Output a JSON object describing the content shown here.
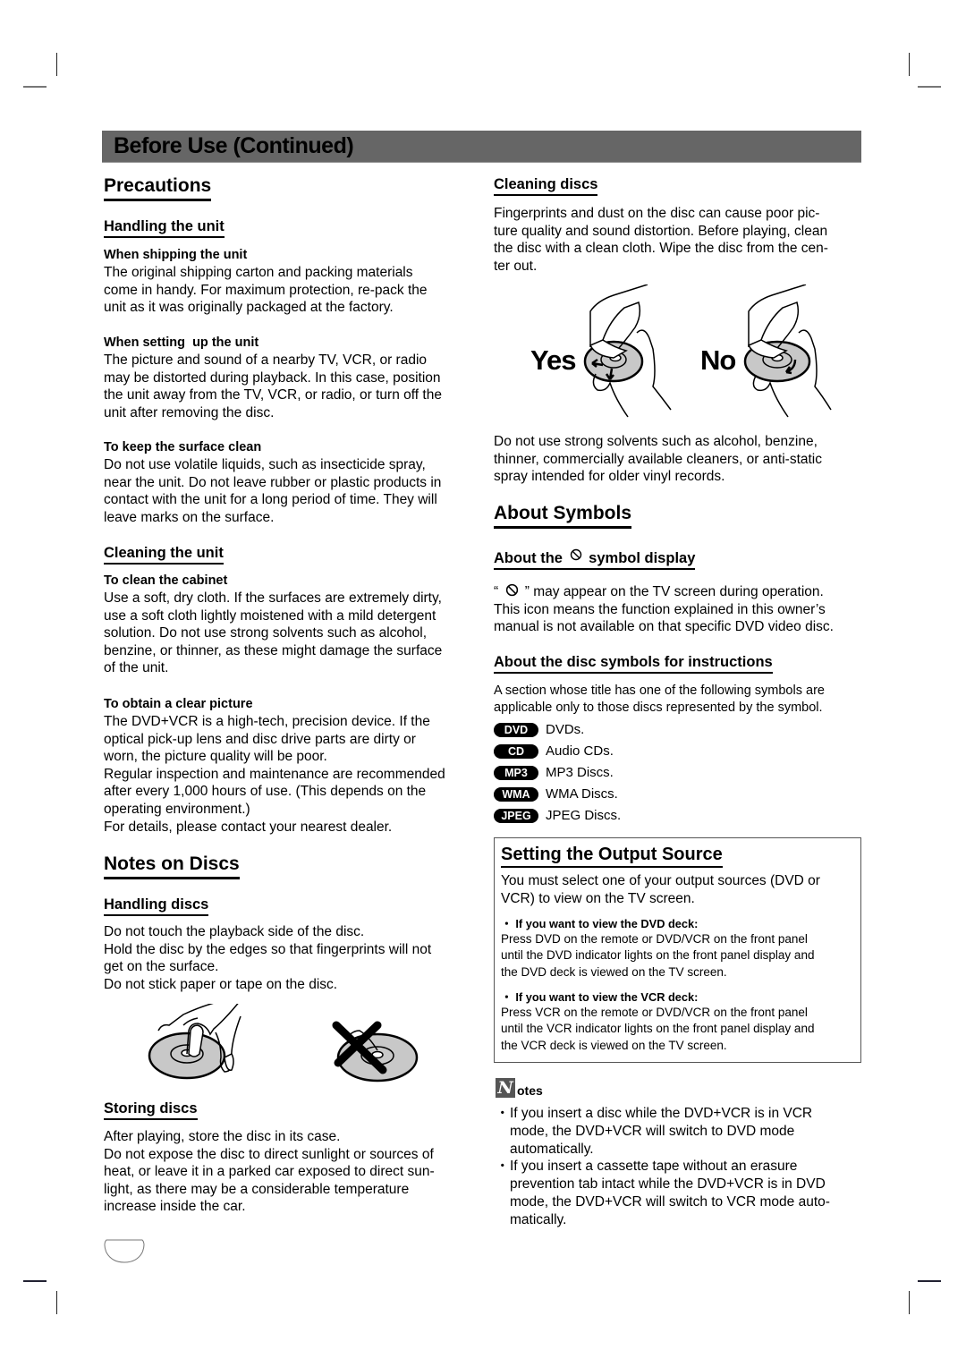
{
  "header": {
    "title": "Before Use (Continued)"
  },
  "left_column": {
    "precautions": {
      "title": "Precautions",
      "handling_unit": {
        "title": "Handling the unit",
        "shipping": {
          "title": "When shipping the unit",
          "lines": [
            "The original shipping carton and packing materials",
            "come in handy. For maximum protection, re-pack the",
            "unit as it was originally packaged at the factory."
          ]
        },
        "setting_up": {
          "title": "When setting  up the unit",
          "lines": [
            "The picture and sound of a nearby TV, VCR, or radio",
            "may be distorted during playback. In this case, position",
            "the unit away from the TV, VCR, or radio, or turn off the",
            "unit after removing the disc."
          ]
        },
        "surface_clean": {
          "title": "To keep the surface clean",
          "lines": [
            "Do not use volatile liquids, such as insecticide spray,",
            "near the unit. Do not leave rubber or plastic products in",
            "contact with the unit for a long period of time. They will",
            "leave marks on the surface."
          ]
        }
      },
      "cleaning_unit": {
        "title": "Cleaning the unit",
        "cabinet": {
          "title": "To clean the cabinet",
          "lines": [
            "Use a soft, dry cloth. If the surfaces are extremely dirty,",
            "use a soft cloth lightly moistened with a mild detergent",
            "solution. Do not use strong solvents such as alcohol,",
            "benzine, or thinner, as these might damage the surface",
            "of the unit."
          ]
        },
        "clear_picture": {
          "title": "To obtain a clear picture",
          "lines": [
            "The DVD+VCR is a high-tech, precision device. If the",
            "optical pick-up lens and disc drive parts are dirty or",
            "worn, the picture quality will be poor.",
            "Regular inspection and maintenance are recommended",
            "after every 1,000 hours of use. (This depends on the",
            "operating environment.)",
            "For details, please contact your nearest dealer."
          ]
        }
      }
    },
    "notes_on_discs": {
      "title": "Notes on Discs",
      "handling_discs": {
        "title": "Handling discs",
        "lines": [
          "Do not touch the playback side of the disc.",
          "Hold the disc by the edges so that fingerprints will not",
          "get on the surface.",
          "Do not stick paper or tape on the disc."
        ]
      },
      "storing_discs": {
        "title": "Storing discs",
        "lines": [
          "After playing, store the disc in its case.",
          "Do not expose the disc to direct sunlight or sources of",
          "heat, or leave it in a parked car exposed to direct sun-",
          "light, as there may be a considerable temperature",
          "increase inside the car."
        ]
      }
    }
  },
  "right_column": {
    "cleaning_discs": {
      "title": "Cleaning discs",
      "lines": [
        "Fingerprints and dust on the disc can cause poor pic-",
        "ture quality and sound distortion. Before playing, clean",
        "the disc with a clean cloth. Wipe the disc from the cen-",
        "ter out."
      ],
      "yes_label": "Yes",
      "no_label": "No",
      "after_lines": [
        "Do not use strong solvents such as alcohol, benzine,",
        "thinner, commercially available cleaners, or anti-static",
        "spray intended for older vinyl records."
      ]
    },
    "about_symbols": {
      "title": "About Symbols",
      "symbol_display": {
        "title_before": "About the",
        "title_after": "symbol display",
        "line1_open": "“",
        "line1_close": "” may appear on the TV screen during operation.",
        "lines": [
          "This icon means the function explained in this owner’s",
          "manual is not available on that specific DVD video disc."
        ]
      },
      "disc_symbols": {
        "title": "About the disc symbols for instructions",
        "lines": [
          "A section whose title has one of the following symbols are",
          "applicable only to those discs represented by the symbol."
        ],
        "items": [
          {
            "badge": "DVD",
            "label": "DVDs."
          },
          {
            "badge": "CD",
            "label": "Audio CDs."
          },
          {
            "badge": "MP3",
            "label": "MP3 Discs."
          },
          {
            "badge": "WMA",
            "label": "WMA Discs."
          },
          {
            "badge": "JPEG",
            "label": "JPEG Discs."
          }
        ]
      }
    },
    "output_source": {
      "title": "Setting the Output Source",
      "intro": [
        "You must select one of your output sources (DVD or",
        "VCR) to view on the TV screen."
      ],
      "dvd": {
        "heading": "・ If you want to view the DVD deck:",
        "lines": [
          "Press DVD on the remote or DVD/VCR on the front panel",
          "until the DVD indicator lights on the front panel display and",
          "the DVD deck is viewed on the TV screen."
        ]
      },
      "vcr": {
        "heading": "・ If you want to view the VCR deck:",
        "lines": [
          "Press VCR on the remote or DVD/VCR on the front panel",
          "until the VCR indicator lights on the front panel display and",
          "the VCR deck is viewed on the TV screen."
        ]
      }
    },
    "notes": {
      "icon_letter": "N",
      "label": "otes",
      "items": [
        {
          "bullet": "・",
          "lines": [
            "If you insert a disc while the DVD+VCR is in VCR",
            "mode, the DVD+VCR will switch to DVD mode",
            "automatically."
          ]
        },
        {
          "bullet": "・",
          "lines": [
            "If you insert a cassette tape without an erasure",
            "prevention tab intact while the DVD+VCR is in DVD",
            "mode, the DVD+VCR will switch to VCR mode auto-",
            "matically."
          ]
        }
      ]
    }
  }
}
